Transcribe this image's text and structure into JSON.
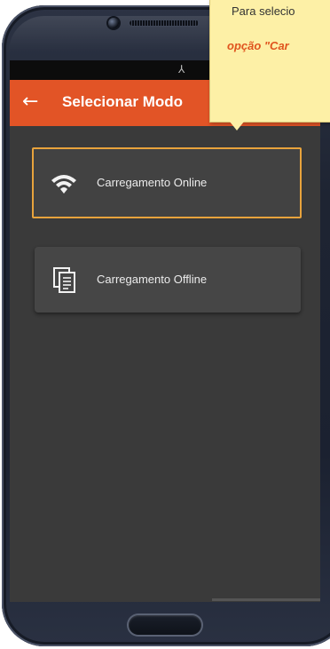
{
  "status_bar": {
    "icon": "mute-vibrate-icon",
    "glyph": "⅄"
  },
  "app_bar": {
    "back_glyph": "←",
    "title": "Selecionar Modo",
    "color": "#e25426"
  },
  "modes": [
    {
      "icon": "wifi-icon",
      "label": "Carregamento Online",
      "highlighted": true
    },
    {
      "icon": "documents-icon",
      "label": "Carregamento Offline",
      "highlighted": false
    }
  ],
  "tooltip": {
    "line1": "Para selecio",
    "line2": "opção \"Car",
    "highlight_color": "#e0541e",
    "background": "#fdf0a6"
  },
  "colors": {
    "screen_bg": "#3a3a3a",
    "card_bg": "#464646",
    "highlight_border": "#e8a33c"
  }
}
